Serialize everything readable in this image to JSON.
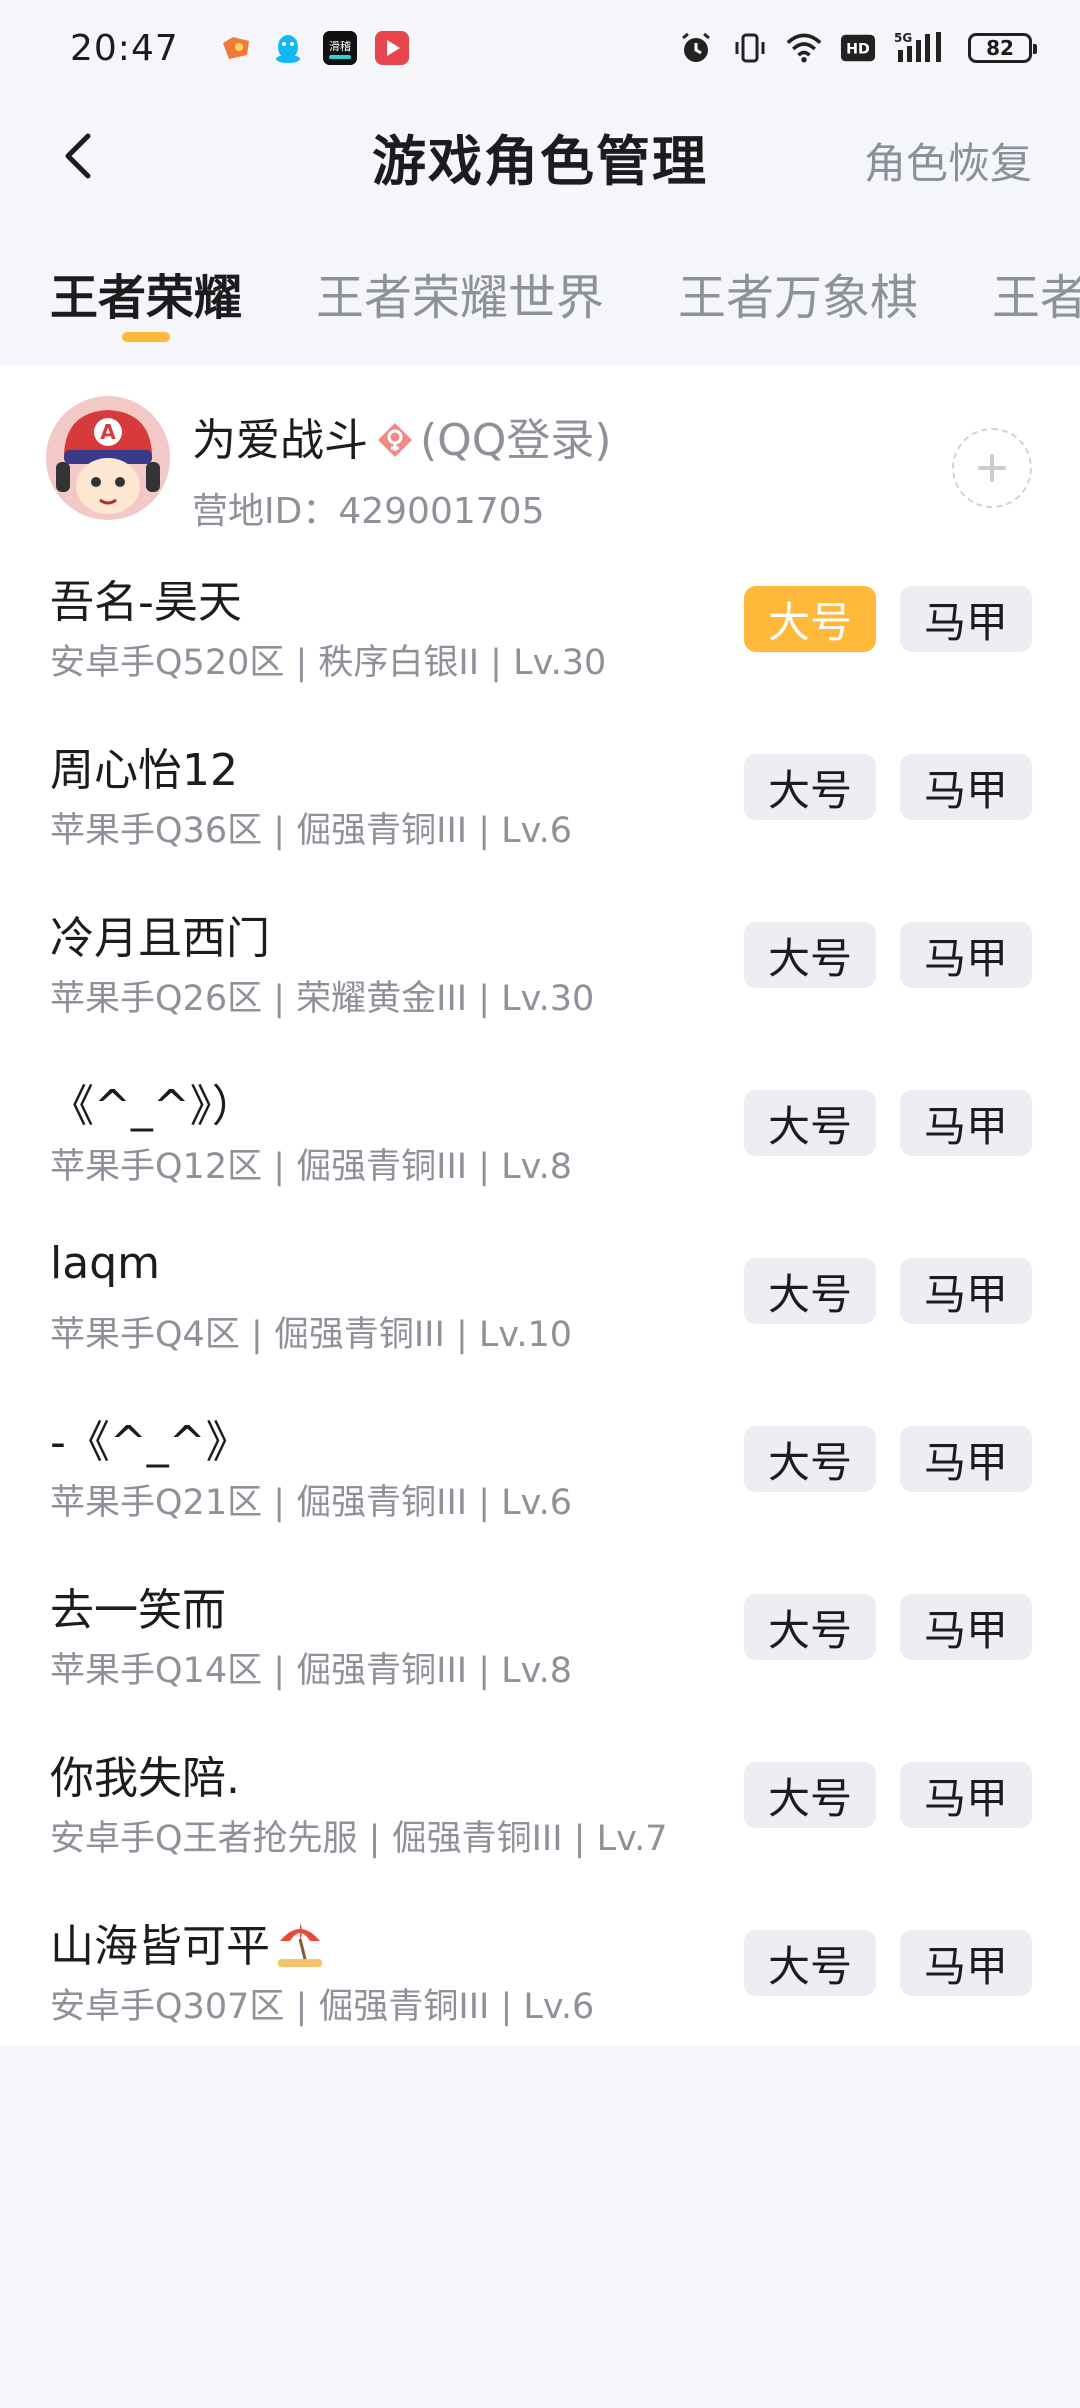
{
  "status_bar": {
    "time": "20:47",
    "battery": "82",
    "signal_label": "5G",
    "hd_label": "HD",
    "app_icons": [
      "game-icon",
      "qq-icon",
      "entertainment-icon",
      "video-icon"
    ],
    "system_icons": [
      "alarm-icon",
      "vibrate-icon",
      "wifi-icon",
      "hd-icon",
      "signal-icon",
      "battery-icon"
    ],
    "ent_label": "滑稽"
  },
  "nav": {
    "title": "游戏角色管理",
    "right_label": "角色恢复"
  },
  "tabs": [
    {
      "label": "王者荣耀",
      "active": true
    },
    {
      "label": "王者荣耀世界",
      "active": false
    },
    {
      "label": "王者万象棋",
      "active": false
    },
    {
      "label": "王者",
      "active": false
    }
  ],
  "account": {
    "name": "为爱战斗",
    "login": "(QQ登录)",
    "id_label": "营地ID：",
    "id_value": "429001705"
  },
  "roles": [
    {
      "name": "吾名-昊天",
      "info": "安卓手Q520区 | 秩序白银II | Lv.30",
      "main_label": "大号",
      "alt_label": "马甲",
      "is_main": true
    },
    {
      "name": "周心怡12",
      "info": "苹果手Q36区 | 倔强青铜III | Lv.6",
      "main_label": "大号",
      "alt_label": "马甲",
      "is_main": false
    },
    {
      "name": "冷月且西门",
      "info": "苹果手Q26区 | 荣耀黄金III | Lv.30",
      "main_label": "大号",
      "alt_label": "马甲",
      "is_main": false
    },
    {
      "name": "《^_^》）",
      "info": "苹果手Q12区 | 倔强青铜III | Lv.8",
      "main_label": "大号",
      "alt_label": "马甲",
      "is_main": false
    },
    {
      "name": "laqm",
      "info": "苹果手Q4区 | 倔强青铜III | Lv.10",
      "main_label": "大号",
      "alt_label": "马甲",
      "is_main": false
    },
    {
      "name": "-《^_^》",
      "info": "苹果手Q21区 | 倔强青铜III | Lv.6",
      "main_label": "大号",
      "alt_label": "马甲",
      "is_main": false
    },
    {
      "name": "去一笑而",
      "info": "苹果手Q14区 | 倔强青铜III | Lv.8",
      "main_label": "大号",
      "alt_label": "马甲",
      "is_main": false
    },
    {
      "name": "你我失陪.",
      "info": "安卓手Q王者抢先服 | 倔强青铜III | Lv.7",
      "main_label": "大号",
      "alt_label": "马甲",
      "is_main": false
    },
    {
      "name": "山海皆可平",
      "info": "安卓手Q307区 | 倔强青铜III | Lv.6",
      "main_label": "大号",
      "alt_label": "马甲",
      "is_main": false
    }
  ],
  "colors": {
    "accent": "#ffb83a",
    "background": "#f4f6fa",
    "secondary_text": "#8e9199",
    "button_bg": "#eceef3"
  }
}
